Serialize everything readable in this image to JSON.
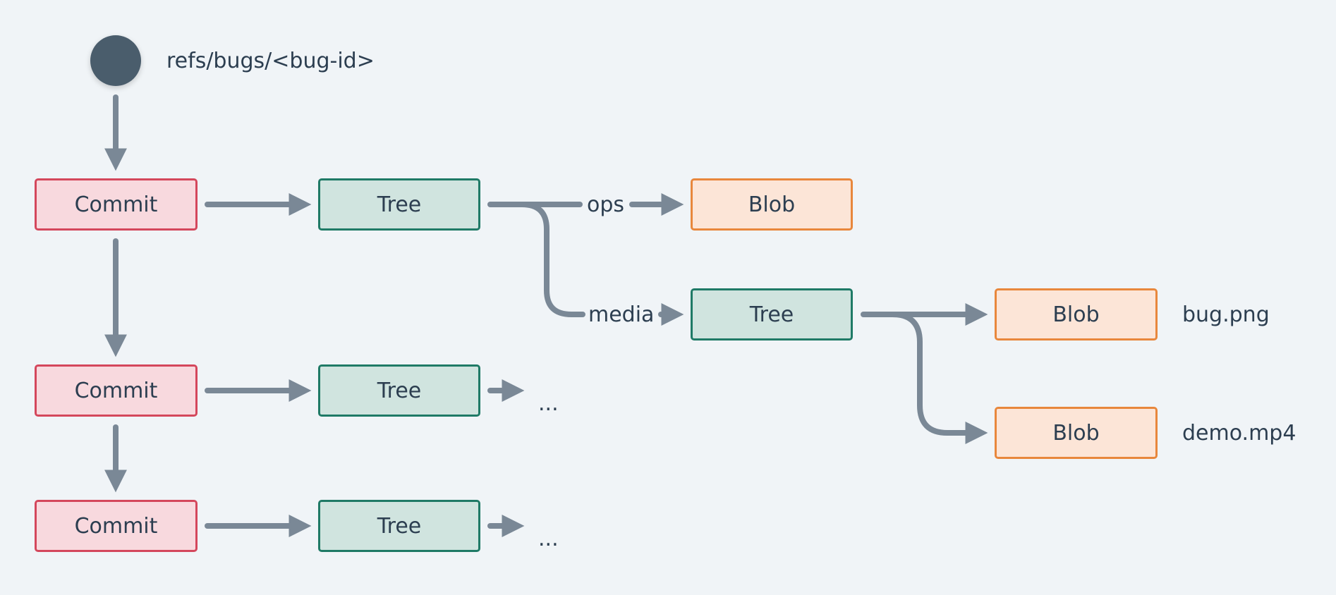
{
  "ref": {
    "label": "refs/bugs/<bug-id>",
    "icon": "ref-circle-icon"
  },
  "colors": {
    "background": "#f0f4f7",
    "edge": "#7a8896",
    "commit_border": "#d4475c",
    "commit_fill": "#f8d9de",
    "tree_border": "#1f7a66",
    "tree_fill": "#d0e4df",
    "blob_border": "#e8873c",
    "blob_fill": "#fce5d7",
    "text": "#2c3e50"
  },
  "nodes": {
    "commit1": "Commit",
    "commit2": "Commit",
    "commit3": "Commit",
    "tree1": "Tree",
    "tree2": "Tree",
    "tree3": "Tree",
    "blob_ops": "Blob",
    "tree_media": "Tree",
    "blob_bug": "Blob",
    "blob_demo": "Blob"
  },
  "edge_labels": {
    "ops": "ops",
    "media": "media"
  },
  "file_labels": {
    "bug": "bug.png",
    "demo": "demo.mp4"
  },
  "ellipsis": {
    "row2": "...",
    "row3": "..."
  }
}
